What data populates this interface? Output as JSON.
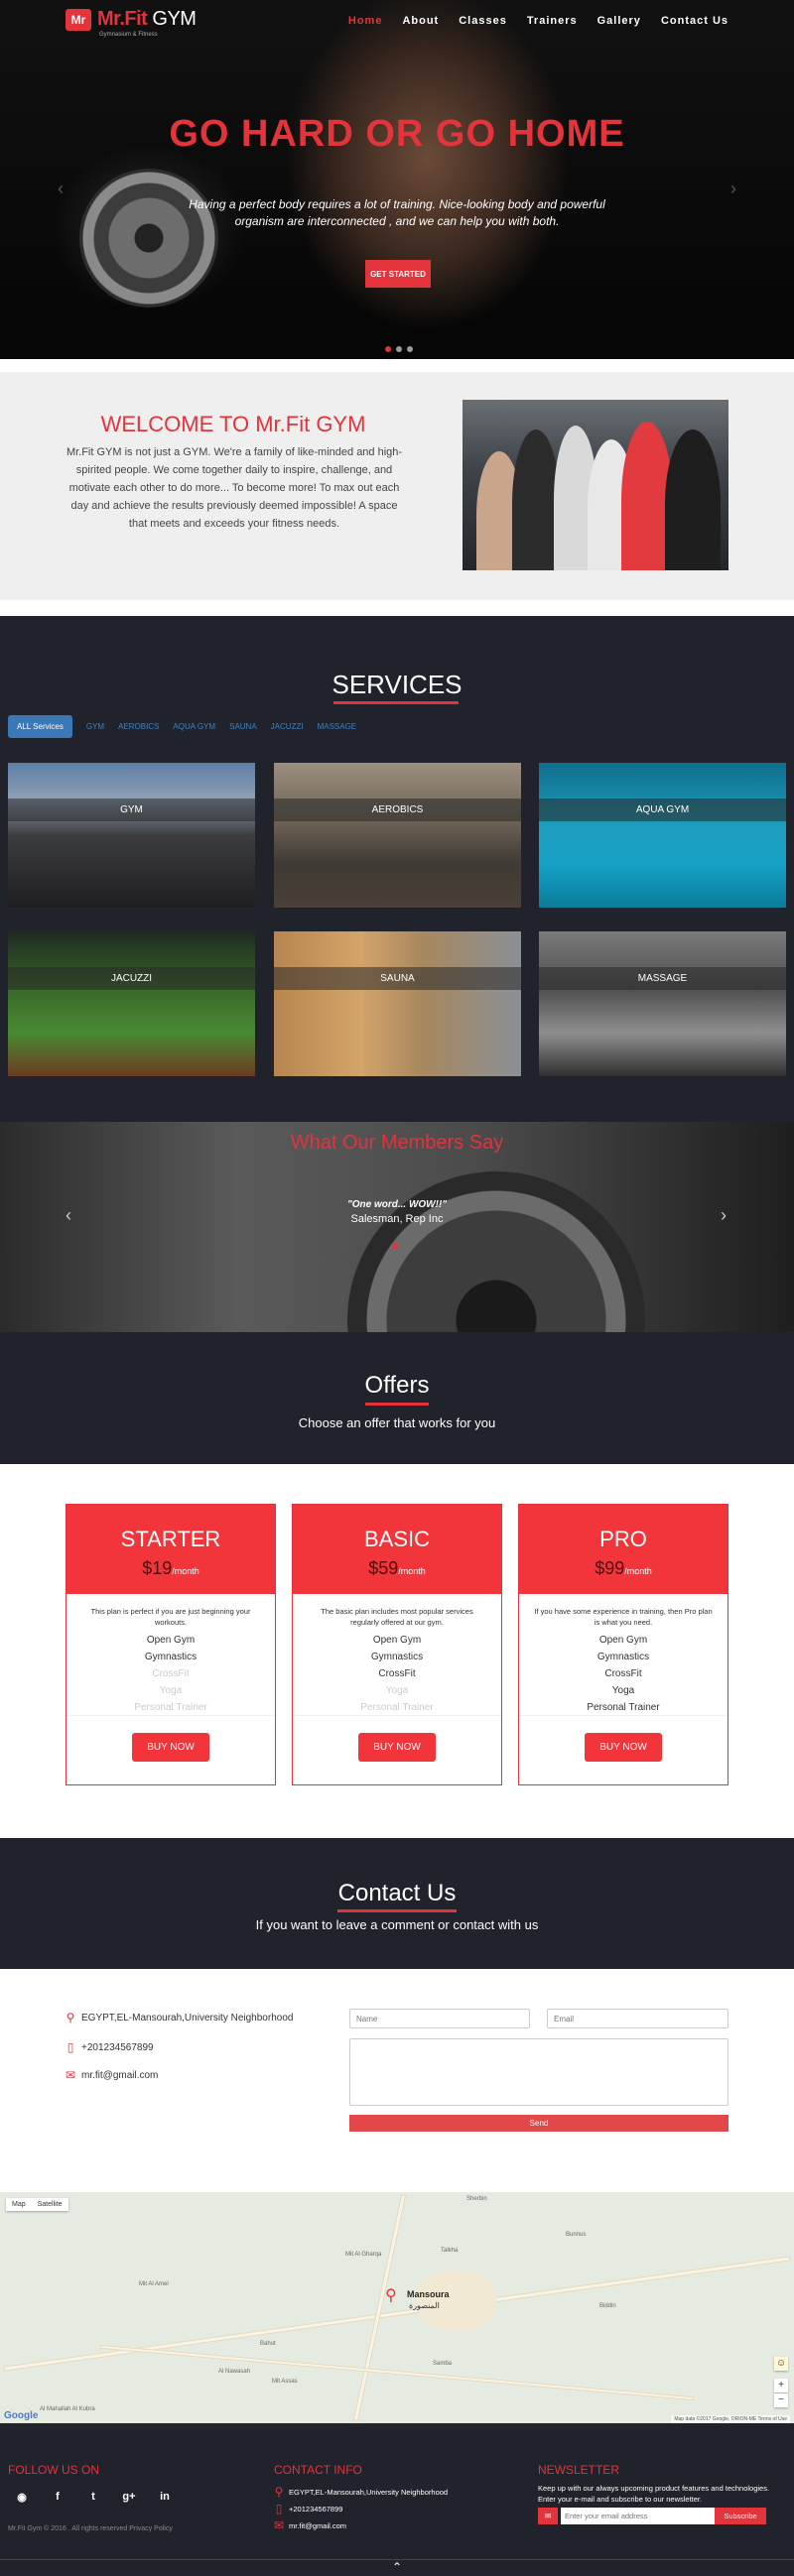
{
  "header": {
    "logo_mark": "Mr",
    "logo_name_red": "Mr.Fit",
    "logo_name_white": "GYM",
    "logo_tagline": "Gymnasium & Fitness",
    "nav": [
      {
        "label": "Home",
        "active": true
      },
      {
        "label": "About",
        "active": false
      },
      {
        "label": "Classes",
        "active": false
      },
      {
        "label": "Trainers",
        "active": false
      },
      {
        "label": "Gallery",
        "active": false
      },
      {
        "label": "Contact Us",
        "active": false
      }
    ]
  },
  "hero": {
    "headline": "GO HARD OR GO HOME",
    "text": "Having a perfect body requires a lot of training. Nice-looking body and powerful organism are interconnected , and we can help you with both.",
    "cta": "GET STARTED",
    "arrow_left": "‹",
    "arrow_right": "›"
  },
  "welcome": {
    "title": "WELCOME TO Mr.Fit GYM",
    "text": "Mr.Fit GYM is not just a GYM. We're a family of like-minded and high-spirited people. We come together daily to inspire, challenge, and motivate each other to do more... To become more! To max out each day and achieve the results previously deemed impossible! A space that meets and exceeds your fitness needs."
  },
  "services": {
    "title": "SERVICES",
    "filters": [
      "ALL Services",
      "GYM",
      "AEROBICS",
      "AQUA GYM",
      "SAUNA",
      "JACUZZI",
      "MASSAGE"
    ],
    "tiles": [
      "GYM",
      "AEROBICS",
      "AQUA GYM",
      "JACUZZI",
      "SAUNA",
      "MASSAGE"
    ]
  },
  "testimonials": {
    "title": "What Our Members Say",
    "quote": "\"One word... WOW!!\"",
    "author": "Salesman, Rep Inc",
    "arrow_left": "‹",
    "arrow_right": "›"
  },
  "offers": {
    "title": "Offers",
    "subtitle": "Choose an offer that works for you"
  },
  "plans": [
    {
      "name": "STARTER",
      "price": "$19",
      "per": "/month",
      "desc": "This plan is perfect if you are just beginning your workouts.",
      "features": [
        "Open Gym",
        "Gymnastics",
        "CrossFit",
        "Yoga",
        "Personal Trainer"
      ],
      "included": [
        true,
        true,
        false,
        false,
        false
      ],
      "button": "BUY NOW"
    },
    {
      "name": "BASIC",
      "price": "$59",
      "per": "/month",
      "desc": "The basic plan includes most popular services regularly offered at our gym.",
      "features": [
        "Open Gym",
        "Gymnastics",
        "CrossFit",
        "Yoga",
        "Personal Trainer"
      ],
      "included": [
        true,
        true,
        true,
        false,
        false
      ],
      "button": "BUY NOW"
    },
    {
      "name": "PRO",
      "price": "$99",
      "per": "/month",
      "desc": "If you have some experience in training, then Pro plan is what you need.",
      "features": [
        "Open Gym",
        "Gymnastics",
        "CrossFit",
        "Yoga",
        "Personal Trainer"
      ],
      "included": [
        true,
        true,
        true,
        true,
        true
      ],
      "button": "BUY NOW"
    }
  ],
  "contact": {
    "title": "Contact Us",
    "subtitle": "If you want to leave a comment or contact with us",
    "address": "EGYPT,EL-Mansourah,University Neighborhood",
    "phone": "+201234567899",
    "email": "mr.fit@gmail.com",
    "name_placeholder": "Name",
    "email_placeholder": "Email",
    "message_placeholder": "",
    "send": "Send"
  },
  "map": {
    "type_map": "Map",
    "type_satellite": "Satellite",
    "place": "Mansoura",
    "place_ar": "المنصورة",
    "labels": [
      "Talkha",
      "Sherbin",
      "Mit Al Gharqa",
      "Biddin",
      "Samba",
      "Mit Assas",
      "Al Nawasah",
      "Bahut",
      "Al Mahallah Al Kubra",
      "Mit Al Amel",
      "Bunnus"
    ],
    "google": "Google",
    "attribution": "Map data ©2017 Google, ORION-ME   Terms of Use",
    "zoom_in": "+",
    "zoom_out": "−"
  },
  "footer": {
    "follow_title": "FOLLOW US ON",
    "social": [
      "rss-icon",
      "facebook-icon",
      "twitter-icon",
      "google-plus-icon",
      "linkedin-icon"
    ],
    "social_glyphs": [
      "◉",
      "f",
      "t",
      "g+",
      "in"
    ],
    "copyright": "Mr.Fit Gym © 2016 . All rights reserved Privacy Policy",
    "contact_title": "CONTACT INFO",
    "address": "EGYPT,EL-Mansourah,University Neighborhood",
    "phone": "+201234567899",
    "email": "mr.fit@gmail.com",
    "newsletter_title": "NEWSLETTER",
    "newsletter_text": "Keep up with our always upcoming product features and technologies. Enter your e-mail and subscribe to our newsletter.",
    "newsletter_placeholder": "Enter your email address",
    "subscribe": "Subscribe",
    "to_top": "⌃"
  },
  "colors": {
    "accent": "#e3333b",
    "dark": "#20232b",
    "link": "#3b82c4"
  }
}
